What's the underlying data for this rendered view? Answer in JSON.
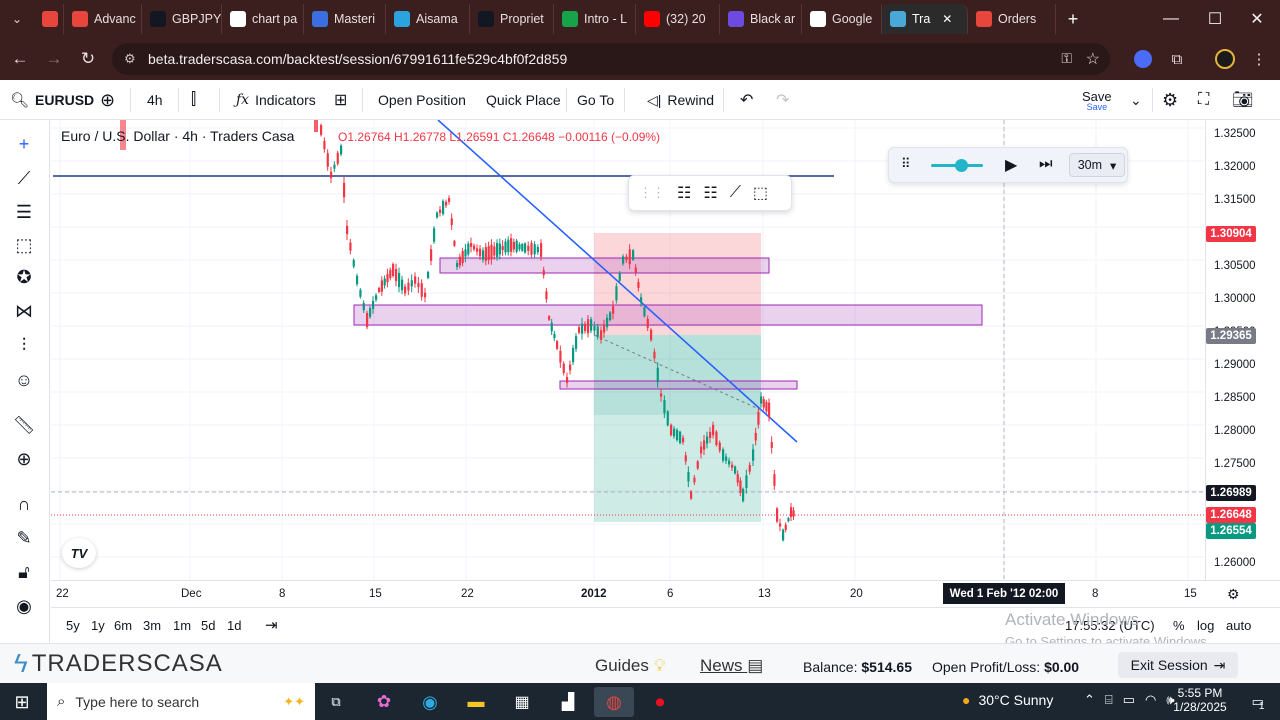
{
  "browser": {
    "tabs": [
      {
        "label": "",
        "favicon": "d-icon",
        "color": "#e8453c"
      },
      {
        "label": "Advanc",
        "favicon": "d-icon",
        "color": "#e8453c"
      },
      {
        "label": "GBPJPY",
        "favicon": "tradingview-icon",
        "color": "#131722"
      },
      {
        "label": "chart pa",
        "favicon": "google-icon",
        "color": "#ffffff"
      },
      {
        "label": "Masteri",
        "favicon": "arrow-icon",
        "color": "#3b6fe0"
      },
      {
        "label": "Aisama",
        "favicon": "telegram-icon",
        "color": "#2aa3df"
      },
      {
        "label": "Propriet",
        "favicon": "qt-icon",
        "color": "#131722"
      },
      {
        "label": "Intro - L",
        "favicon": "check-icon",
        "color": "#16a34a"
      },
      {
        "label": "(32) 20",
        "favicon": "youtube-icon",
        "color": "#ff0000"
      },
      {
        "label": "Black ar",
        "favicon": "heart-icon",
        "color": "#6d4ae0"
      },
      {
        "label": "Google",
        "favicon": "google-icon",
        "color": "#ffffff"
      },
      {
        "label": "Tra",
        "favicon": "traderscasa-icon",
        "color": "#4aa8d8"
      },
      {
        "label": "Orders",
        "favicon": "d-icon",
        "color": "#e8453c"
      }
    ],
    "url": "beta.traderscasa.com/backtest/session/67991611fe529c4bf0f2d859"
  },
  "toolbar": {
    "symbol": "EURUSD",
    "interval": "4h",
    "indicators": "Indicators",
    "open_position": "Open Position",
    "quick_place": "Quick Place",
    "go_to": "Go To",
    "rewind": "Rewind",
    "save": "Save",
    "save_sub": "Save"
  },
  "chart": {
    "legend_title": "Euro / U.S. Dollar · 4h · Traders Casa",
    "ohlc": "O1.26764 H1.26778 L1.26591 C1.26648 −0.00116 (−0.09%)",
    "price_scale": [
      "1.32500",
      "1.32000",
      "1.31500",
      "1.31000",
      "1.30500",
      "1.30000",
      "1.29500",
      "1.29000",
      "1.28500",
      "1.28000",
      "1.27500",
      "1.27000",
      "1.26500",
      "1.26000"
    ],
    "price_tags": [
      {
        "label": "1.30904",
        "color": "#f23645"
      },
      {
        "label": "1.29365",
        "color": "#787b86"
      },
      {
        "label": "1.26989",
        "color": "#131722"
      },
      {
        "label": "1.26648",
        "color": "#f23645"
      },
      {
        "label": "1.26554",
        "color": "#089981"
      }
    ],
    "time_labels": [
      "22",
      "Dec",
      "8",
      "15",
      "22",
      "2012",
      "6",
      "13",
      "20",
      "8",
      "15"
    ],
    "crosshair_time": "Wed 1 Feb '12   02:00",
    "replay_interval": "30m",
    "watermark": "TV"
  },
  "bottom": {
    "ranges": [
      "5y",
      "1y",
      "6m",
      "3m",
      "1m",
      "5d",
      "1d"
    ],
    "clock": "17:55:32 (UTC)",
    "pct": "%",
    "log": "log",
    "auto": "auto",
    "activate_title": "Activate Windows",
    "activate_sub": "Go to Settings to activate Windows."
  },
  "footer": {
    "brand": "TRADERSCASA",
    "guides": "Guides",
    "news": "News",
    "balance_label": "Balance:",
    "balance_value": "$514.65",
    "pnl_label": "Open Profit/Loss:",
    "pnl_value": "$0.00",
    "exit": "Exit Session"
  },
  "taskbar": {
    "search_placeholder": "Type here to search",
    "weather": "30°C  Sunny",
    "time": "5:55 PM",
    "date": "1/28/2025",
    "notifications": "1"
  }
}
